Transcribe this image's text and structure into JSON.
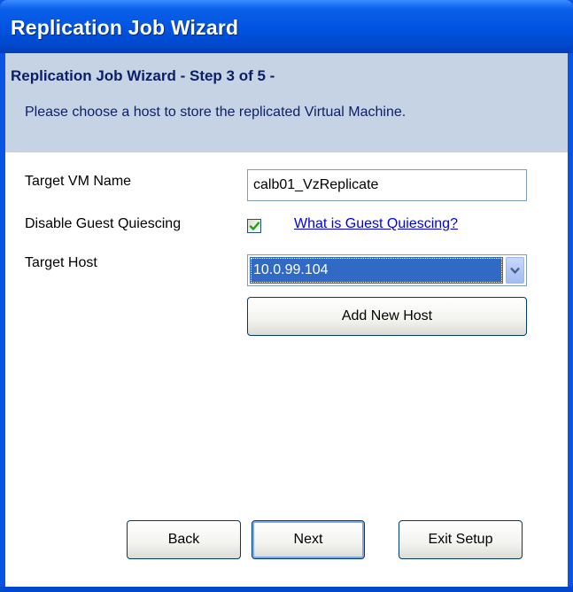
{
  "window": {
    "title": "Replication Job Wizard"
  },
  "header": {
    "step_title": "Replication Job Wizard - Step 3 of 5 -",
    "description": "Please choose a host to store the replicated Virtual Machine."
  },
  "form": {
    "target_vm_name_label": "Target VM Name",
    "target_vm_name_value": "calb01_VzReplicate",
    "disable_quiescing_label": "Disable Guest Quiescing",
    "disable_quiescing_checked": true,
    "quiescing_help_link": "What is Guest Quiescing?",
    "target_host_label": "Target Host",
    "target_host_value": "10.0.99.104",
    "add_host_button": "Add New Host"
  },
  "footer": {
    "back_button": "Back",
    "next_button": "Next",
    "exit_button": "Exit Setup"
  },
  "colors": {
    "titlebar": "#0053e0",
    "header_band": "#c6d3e4",
    "selection": "#316ac5",
    "link": "#0000ee"
  },
  "icons": {
    "checkbox_check": "check-icon",
    "dropdown_arrow": "chevron-down-icon"
  }
}
